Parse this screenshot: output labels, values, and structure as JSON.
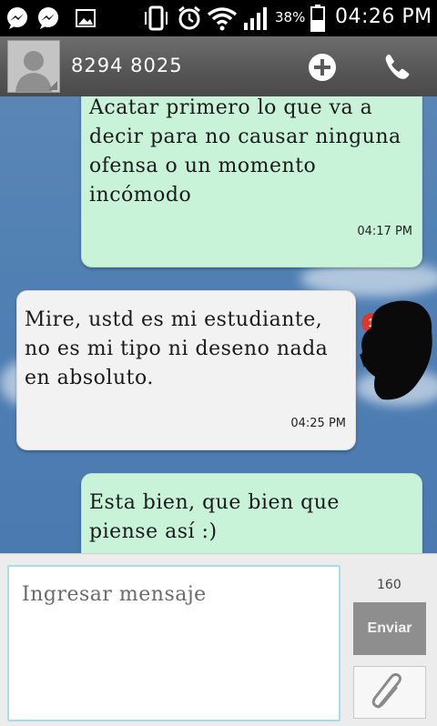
{
  "status_bar": {
    "battery_percent": "38%",
    "time": "04:26 PM",
    "icons": [
      "messenger-icon",
      "messenger-icon",
      "image-icon",
      "vibrate-icon",
      "alarm-icon",
      "wifi-icon",
      "signal-icon",
      "battery-icon"
    ]
  },
  "header": {
    "contact_name": "8294 8025",
    "icons": [
      "avatar-icon",
      "add-icon",
      "phone-icon"
    ]
  },
  "messages": [
    {
      "direction": "outgoing",
      "text": "Acatar primero lo que va a\ndecir para no causar ninguna\nofensa o un momento\nincómodo",
      "time": "04:17 PM"
    },
    {
      "direction": "incoming",
      "text": "Mire, ustd es mi estudiante,\nno es mi tipo ni deseno nada\nen absoluto.",
      "time": "04:25 PM",
      "badge": "1"
    },
    {
      "direction": "outgoing",
      "text": "Esta bien, que bien que\npiense así :)",
      "time": ""
    }
  ],
  "composer": {
    "placeholder": "Ingresar mensaje",
    "char_counter": "160",
    "send_label": "Enviar",
    "attach_icon": "paperclip-icon"
  },
  "colors": {
    "outgoing_bubble": "#c8f3d9",
    "incoming_bubble": "#f2f2f2",
    "background": "#4f7fb3",
    "badge": "#d83a2e"
  }
}
